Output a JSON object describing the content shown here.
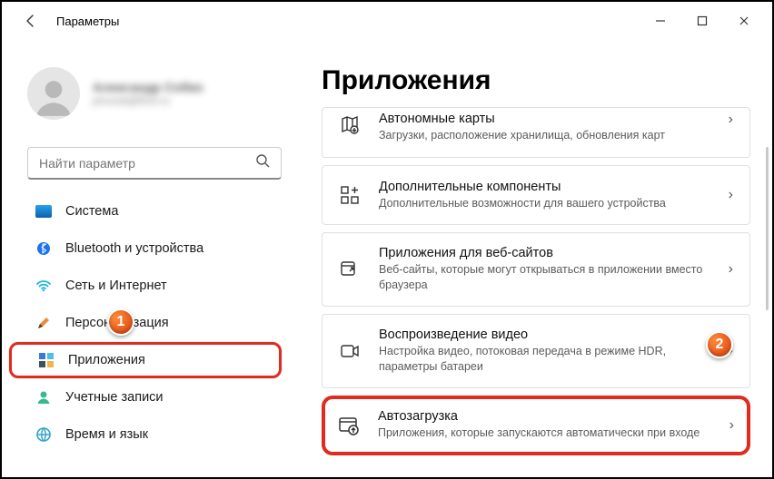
{
  "window": {
    "title": "Параметры"
  },
  "profile": {
    "name": "Александр Собко",
    "email": "privsob@first-ru"
  },
  "search": {
    "placeholder": "Найти параметр"
  },
  "sidebar": {
    "items": [
      {
        "label": "Система"
      },
      {
        "label": "Bluetooth и устройства"
      },
      {
        "label": "Сеть и Интернет"
      },
      {
        "label": "Персонализация"
      },
      {
        "label": "Приложения"
      },
      {
        "label": "Учетные записи"
      },
      {
        "label": "Время и язык"
      }
    ]
  },
  "main": {
    "heading": "Приложения",
    "cards": [
      {
        "title": "Автономные карты",
        "desc": "Загрузки, расположение хранилища, обновления карт"
      },
      {
        "title": "Дополнительные компоненты",
        "desc": "Дополнительные возможности для вашего устройства"
      },
      {
        "title": "Приложения для веб-сайтов",
        "desc": "Веб-сайты, которые могут открываться в приложении вместо браузера"
      },
      {
        "title": "Воспроизведение видео",
        "desc": "Настройка видео, потоковая передача в режиме HDR, параметры батареи"
      },
      {
        "title": "Автозагрузка",
        "desc": "Приложения, которые запускаются автоматически при входе"
      }
    ]
  },
  "callouts": {
    "one": "1",
    "two": "2"
  }
}
